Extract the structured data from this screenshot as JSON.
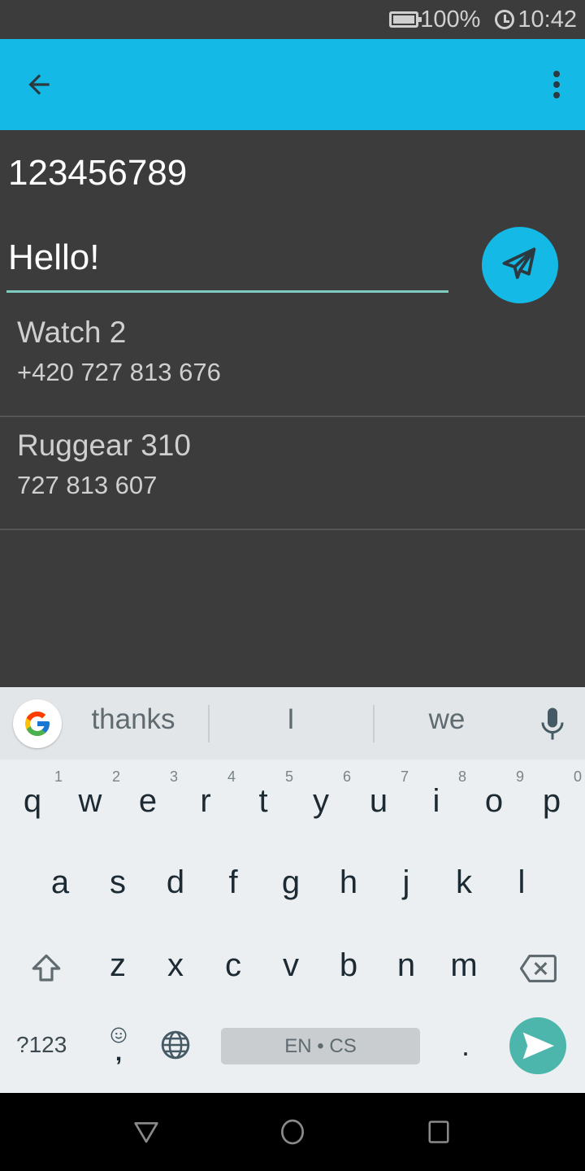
{
  "status_bar": {
    "battery": "100%",
    "time": "10:42"
  },
  "app_bar": {
    "back_icon": "arrow-back-icon",
    "menu_icon": "more-vert-icon"
  },
  "compose": {
    "recipient_number": "123456789",
    "message_value": "Hello!",
    "message_placeholder": "",
    "send_icon": "paper-plane-icon"
  },
  "contacts": [
    {
      "name": "Watch 2",
      "phone": "+420 727 813 676"
    },
    {
      "name": "Ruggear 310",
      "phone": "727 813 607"
    }
  ],
  "keyboard": {
    "suggestions": [
      "thanks",
      "I",
      "we"
    ],
    "row1": [
      {
        "key": "q",
        "hint": "1"
      },
      {
        "key": "w",
        "hint": "2"
      },
      {
        "key": "e",
        "hint": "3"
      },
      {
        "key": "r",
        "hint": "4"
      },
      {
        "key": "t",
        "hint": "5"
      },
      {
        "key": "y",
        "hint": "6"
      },
      {
        "key": "u",
        "hint": "7"
      },
      {
        "key": "i",
        "hint": "8"
      },
      {
        "key": "o",
        "hint": "9"
      },
      {
        "key": "p",
        "hint": "0"
      }
    ],
    "row2": [
      "a",
      "s",
      "d",
      "f",
      "g",
      "h",
      "j",
      "k",
      "l"
    ],
    "row3": [
      "z",
      "x",
      "c",
      "v",
      "b",
      "n",
      "m"
    ],
    "symbols_label": "?123",
    "comma": ",",
    "period": ".",
    "space_label": "EN • CS",
    "colors": {
      "enter": "#4db6ac",
      "accent": "#14b9e6"
    }
  }
}
